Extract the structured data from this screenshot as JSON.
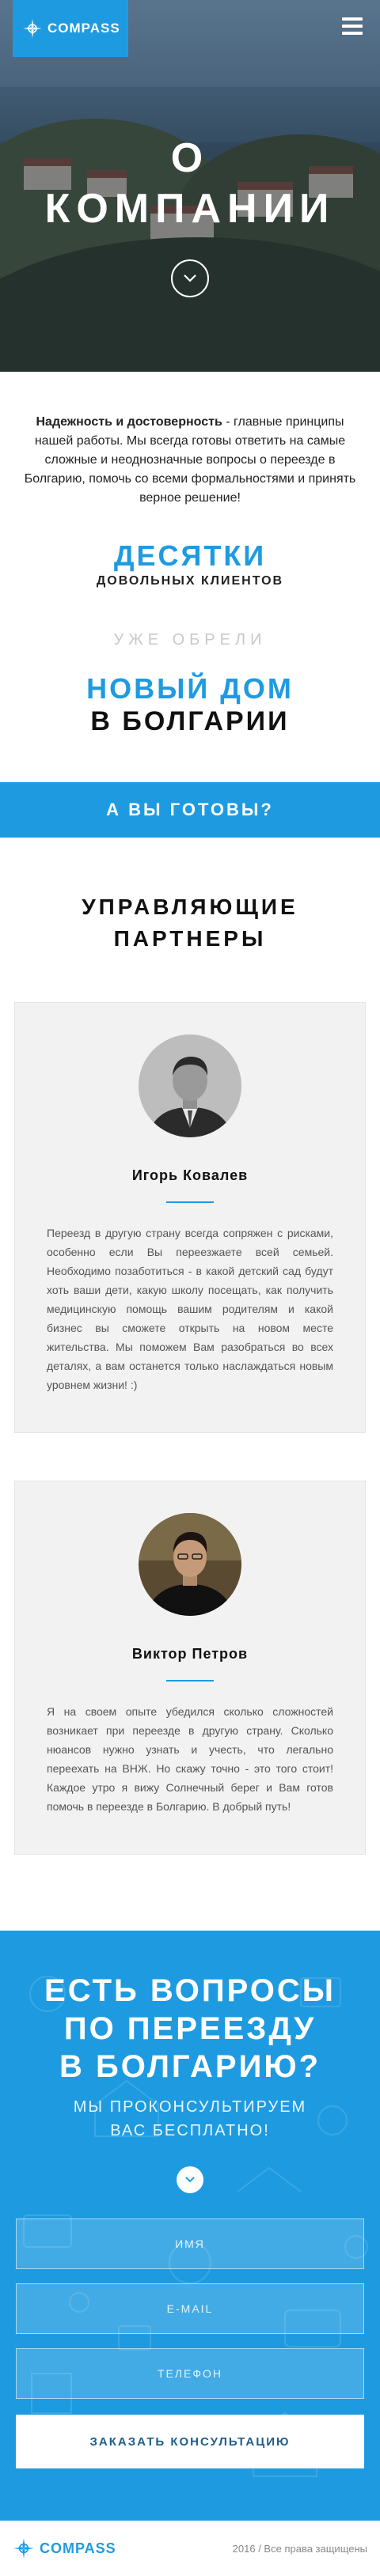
{
  "header": {
    "logo_text": "COMPASS",
    "menu_icon": "hamburger-icon"
  },
  "hero": {
    "title_line1": "О",
    "title_line2": "КОМПАНИИ",
    "scroll_icon": "chevron-down-icon"
  },
  "intro": {
    "bold_lead": "Надежность и достоверность",
    "text": " - главные принципы нашей работы. Мы всегда готовы ответить на самые сложные и неоднозначные вопросы о переезде в Болгарию, помочь со всеми формальностями и принять верное решение!"
  },
  "stats": {
    "line1": "ДЕСЯТКИ",
    "line2": "ДОВОЛЬНЫХ КЛИЕНТОВ",
    "line3": "УЖЕ ОБРЕЛИ",
    "line4": "НОВЫЙ ДОМ",
    "line5": "В БОЛГАРИИ"
  },
  "ready_banner": "А ВЫ ГОТОВЫ?",
  "partners": {
    "title_line1": "УПРАВЛЯЮЩИЕ",
    "title_line2": "ПАРТНЕРЫ",
    "items": [
      {
        "name": "Игорь Ковалев",
        "text": "Переезд в другую страну всегда сопряжен с рисками, особенно если Вы переезжаете всей семьей. Необходимо позаботиться - в какой детский сад будут хоть ваши дети, какую школу посещать, как получить медицинскую помощь вашим родителям и какой бизнес вы сможете открыть на новом месте жительства. Мы поможем Вам разобраться во всех деталях, а вам останется только наслаждаться новым уровнем жизни! :)"
      },
      {
        "name": "Виктор Петров",
        "text": "Я на своем опыте убедился сколько сложностей возникает при переезде в другую страну. Сколько нюансов нужно узнать и учесть, что легально переехать на ВНЖ. Но скажу точно - это того стоит! Каждое утро я вижу Солнечный берег и Вам готов помочь в переезде в Болгарию. В добрый путь!"
      }
    ]
  },
  "cta": {
    "title_line1": "ЕСТЬ ВОПРОСЫ",
    "title_line2": "ПО ПЕРЕЕЗДУ",
    "title_line3": "В БОЛГАРИЮ?",
    "sub_line1": "МЫ ПРОКОНСУЛЬТИРУЕМ",
    "sub_line2": "ВАС БЕСПЛАТНО!",
    "name_placeholder": "ИМЯ",
    "email_placeholder": "E-MAIL",
    "phone_placeholder": "ТЕЛЕФОН",
    "submit_label": "ЗАКАЗАТЬ КОНСУЛЬТАЦИЮ"
  },
  "footer": {
    "logo_text": "COMPASS",
    "copyright": "2016 / Все права защищены"
  },
  "colors": {
    "accent": "#1e9be0",
    "text": "#222222",
    "muted": "#c9c9c9",
    "card_bg": "#f2f2f2"
  }
}
